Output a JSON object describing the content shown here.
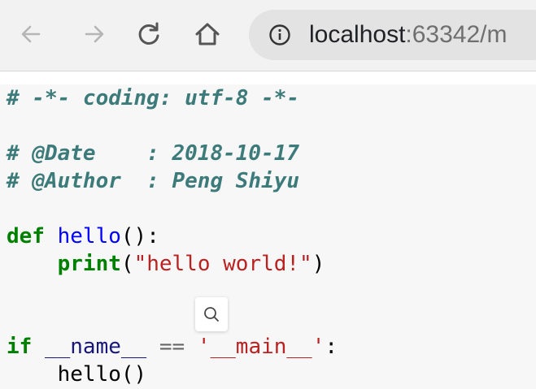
{
  "browser": {
    "url_host": "localhost",
    "url_rest": ":63342/m",
    "icons": {
      "back": "arrow-left-icon",
      "forward": "arrow-right-icon",
      "reload": "reload-icon",
      "home": "home-icon",
      "site_info": "info-circle-icon"
    }
  },
  "code": {
    "line1": "# -*- coding: utf-8 -*-",
    "line3": "# @Date    : 2018-10-17",
    "line4": "# @Author  : Peng Shiyu",
    "line6_kw": "def",
    "line6_fn": "hello",
    "line6_rest": "():",
    "line7_indent": "    ",
    "line7_bi": "print",
    "line7_open": "(",
    "line7_str": "\"hello world!\"",
    "line7_close": ")",
    "line10_kw": "if",
    "line10_name": "__name__",
    "line10_op": "==",
    "line10_str": "'__main__'",
    "line10_colon": ":",
    "line11": "    hello()"
  },
  "popup": {
    "icon": "search-icon"
  },
  "colors": {
    "comment": "#3d7b7b",
    "keyword": "#008000",
    "function": "#0000ff",
    "string": "#ba2121",
    "name": "#19177c"
  }
}
